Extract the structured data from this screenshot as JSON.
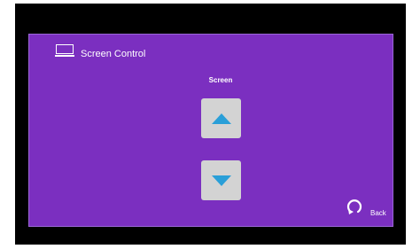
{
  "header": {
    "icon": "screen-icon",
    "title": "Screen Control"
  },
  "section": {
    "label": "Screen"
  },
  "controls": {
    "up_icon": "arrow-up-icon",
    "down_icon": "arrow-down-icon",
    "arrow_color": "#2a9fd8",
    "button_color": "#d3d3d3"
  },
  "footer": {
    "back_icon": "back-arrow-icon",
    "back_label": "Back"
  },
  "colors": {
    "background": "#7b2fc0",
    "bezel": "#000000",
    "text": "#ffffff"
  }
}
